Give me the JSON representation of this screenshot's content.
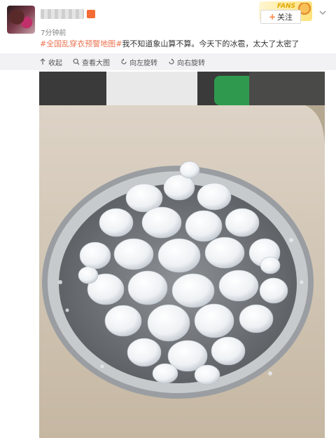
{
  "header": {
    "time": "7分钟前",
    "follow_label": "关注",
    "follow_plus": "+",
    "fans_badge_text": "FANS"
  },
  "post": {
    "hashtag": "#全国乱穿衣预警地图#",
    "text": "我不知道象山算不算。今天下的冰雹，太大了太密了"
  },
  "toolbar": {
    "items": [
      {
        "label": "收起",
        "icon": "collapse-arrow-icon"
      },
      {
        "label": "查看大图",
        "icon": "magnifier-icon"
      },
      {
        "label": "向左旋转",
        "icon": "rotate-left-icon"
      },
      {
        "label": "向右旋转",
        "icon": "rotate-right-icon"
      }
    ]
  },
  "colors": {
    "hashtag": "#eb7350",
    "follow_plus": "#ff8140",
    "toolbar_bg": "#f2f2f5",
    "time": "#808080"
  }
}
